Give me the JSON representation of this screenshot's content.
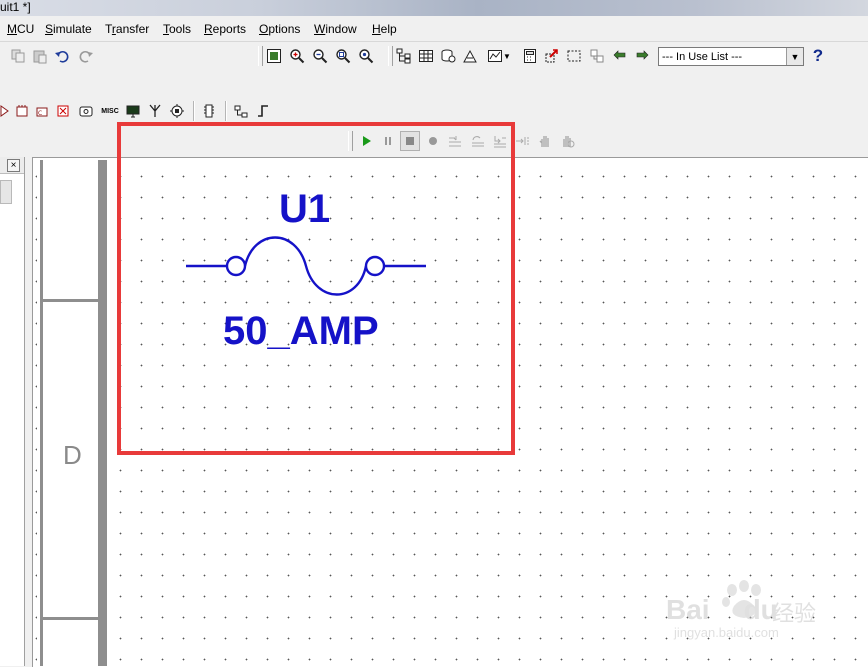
{
  "window": {
    "title_fragment": "uit1 *]"
  },
  "menu": [
    {
      "label": "MCU",
      "u": "M"
    },
    {
      "label": "Simulate",
      "u": "S"
    },
    {
      "label": "Transfer",
      "u": "r"
    },
    {
      "label": "Tools",
      "u": "T"
    },
    {
      "label": "Reports",
      "u": "R"
    },
    {
      "label": "Options",
      "u": "O"
    },
    {
      "label": "Window",
      "u": "W"
    },
    {
      "label": "Help",
      "u": "H"
    }
  ],
  "toolbar": {
    "in_use_list": "--- In Use List ---",
    "help": "?",
    "misc_label": "MISC"
  },
  "panel": {
    "close": "×"
  },
  "schematic": {
    "zone_label": "D",
    "component": {
      "refdes": "U1",
      "value": "50_AMP",
      "color": "#1512c8"
    },
    "highlight_color": "#e83a3a"
  },
  "watermark": {
    "brand_left": "Bai",
    "brand_right": "du",
    "cn": "经验",
    "url": "jingyan.baidu.com"
  }
}
